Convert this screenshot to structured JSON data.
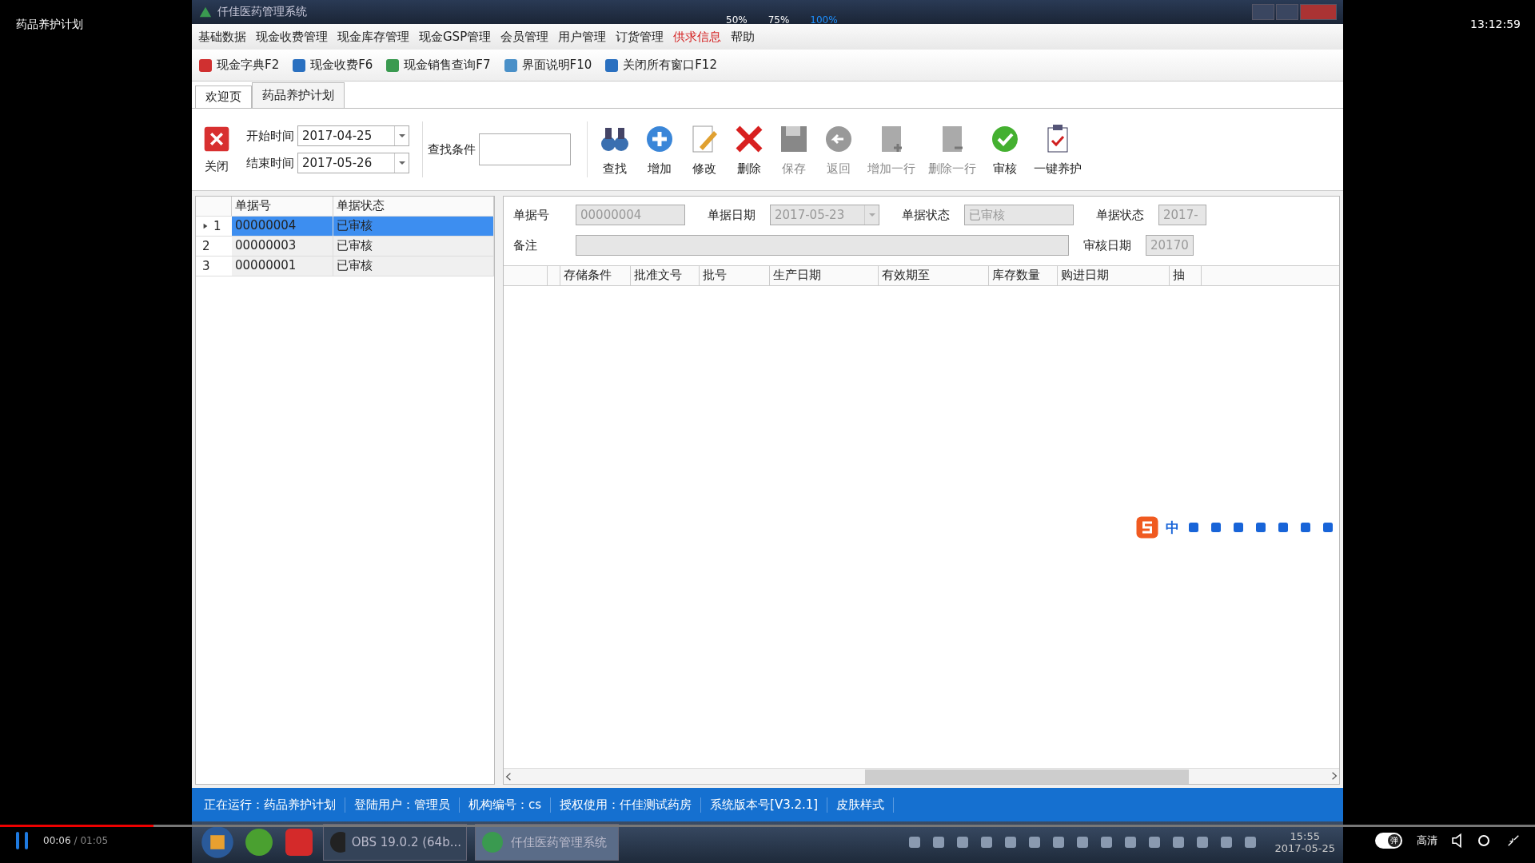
{
  "player": {
    "title": "药品养护计划",
    "clock": "13:12:59",
    "playing": true,
    "progress": {
      "level": 0.1
    },
    "time_current": "00:06",
    "time_total": "/ 01:05",
    "danmaku": {
      "label": "弹",
      "on": true
    },
    "quality": "高清"
  },
  "zoom_options": [
    {
      "label": "50%",
      "selected": false
    },
    {
      "label": "75%",
      "selected": false
    },
    {
      "label": "100%",
      "selected": true
    }
  ],
  "window": {
    "title": "仟佳医药管理系统"
  },
  "menu": [
    {
      "label": "基础数据",
      "highlighted": false
    },
    {
      "label": "现金收费管理",
      "highlighted": false
    },
    {
      "label": "现金库存管理",
      "highlighted": false
    },
    {
      "label": "现金GSP管理",
      "highlighted": false
    },
    {
      "label": "会员管理",
      "highlighted": false
    },
    {
      "label": "用户管理",
      "highlighted": false
    },
    {
      "label": "订货管理",
      "highlighted": false
    },
    {
      "label": "供求信息",
      "highlighted": true
    },
    {
      "label": "帮助",
      "highlighted": false
    }
  ],
  "quick_bar": [
    "现金字典F2",
    "现金收费F6",
    "现金销售查询F7",
    "界面说明F10",
    "关闭所有窗口F12"
  ],
  "tabs": [
    {
      "label": "欢迎页",
      "selected": false
    },
    {
      "label": "药品养护计划",
      "selected": true
    }
  ],
  "toolbar": {
    "close": "关闭",
    "start_label": "开始时间",
    "start_value": "2017-04-25",
    "end_label": "结束时间",
    "end_value": "2017-05-26",
    "search_label": "查找条件",
    "buttons": [
      {
        "label": "查找",
        "disabled": false
      },
      {
        "label": "增加",
        "disabled": false
      },
      {
        "label": "修改",
        "disabled": false
      },
      {
        "label": "删除",
        "disabled": false
      },
      {
        "label": "保存",
        "disabled": true
      },
      {
        "label": "返回",
        "disabled": true
      },
      {
        "label": "增加一行",
        "disabled": true
      },
      {
        "label": "删除一行",
        "disabled": true
      },
      {
        "label": "审核",
        "disabled": false
      },
      {
        "label": "一键养护",
        "disabled": false
      }
    ]
  },
  "list": {
    "columns": [
      "单据号",
      "单据状态"
    ],
    "rows": [
      {
        "index": "1",
        "number": "00000004",
        "status": "已审核",
        "selected": true
      },
      {
        "index": "2",
        "number": "00000003",
        "status": "已审核",
        "selected": false
      },
      {
        "index": "3",
        "number": "00000001",
        "status": "已审核",
        "selected": false
      }
    ]
  },
  "form": {
    "fields": [
      {
        "label": "单据号",
        "value": "00000004",
        "kind": "text"
      },
      {
        "label": "单据日期",
        "value": "2017-05-23",
        "kind": "date"
      },
      {
        "label": "单据状态",
        "value": "已审核",
        "kind": "text"
      },
      {
        "label": "单据状态",
        "value": "2017-",
        "kind": "text"
      }
    ],
    "remark_label": "备注",
    "audit_label": "审核日期",
    "audit_value": "20170"
  },
  "detail_grid": {
    "columns": [
      "存储条件",
      "批准文号",
      "批号",
      "生产日期",
      "有效期至",
      "库存数量",
      "购进日期",
      "抽"
    ]
  },
  "ime_bar": {
    "mode": "中"
  },
  "status_bar": [
    "正在运行：药品养护计划",
    "登陆用户：管理员",
    "机构编号：cs",
    "授权使用：仟佳测试药房",
    "系统版本号[V3.2.1]",
    "皮肤样式"
  ],
  "taskbar": {
    "apps": [
      {
        "label": "OBS 19.0.2 (64b...",
        "active": false
      },
      {
        "label": "仟佳医药管理系统",
        "active": true
      }
    ],
    "time": "15:55",
    "date": "2017-05-25"
  }
}
